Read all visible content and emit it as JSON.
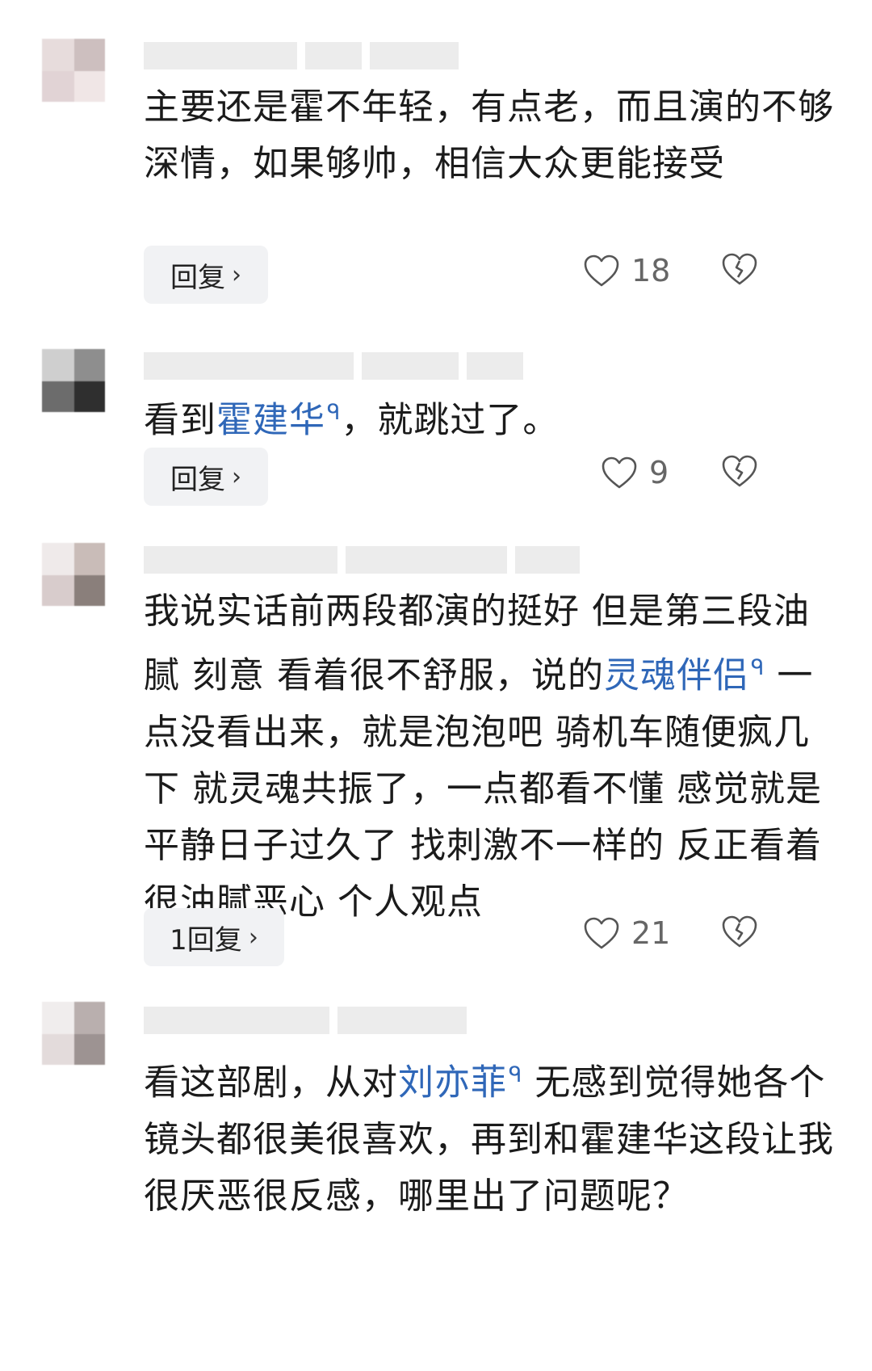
{
  "comments": [
    {
      "text": "主要还是霍不年轻，有点老，而且演的不够深情，如果够帅，相信大众更能接受",
      "reply_label": "回复",
      "likes": "18"
    },
    {
      "text_before": "看到",
      "link": "霍建华",
      "text_after": "，就跳过了。",
      "reply_label": "回复",
      "likes": "9"
    },
    {
      "text_before": "我说实话前两段都演的挺好 但是第三段油腻 刻意 看着很不舒服，说的",
      "link": "灵魂伴侣",
      "text_after": " 一点没看出来，就是泡泡吧 骑机车随便疯几下 就灵魂共振了，一点都看不懂 感觉就是平静日子过久了 找刺激不一样的 反正看着很油腻恶心 个人观点",
      "reply_label": "1回复",
      "likes": "21"
    },
    {
      "text_before": "看这部剧，从对",
      "link": "刘亦菲",
      "text_after": " 无感到觉得她各个镜头都很美很喜欢，再到和霍建华这段让我很厌恶很反感，哪里出了问题呢？"
    }
  ],
  "icons": {
    "like": "heart-outline-icon",
    "dislike": "broken-heart-icon",
    "reply_arrow": "chevron-right-icon",
    "link_search": "search-icon"
  },
  "colors": {
    "link": "#2f67b8",
    "button_bg": "#f1f2f4",
    "count": "#666666"
  }
}
